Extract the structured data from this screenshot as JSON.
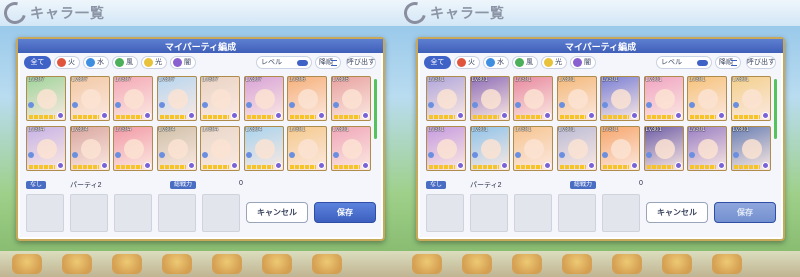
{
  "screen": {
    "title": "キャラ一覧"
  },
  "dialog": {
    "title": "マイパーティ編成",
    "filters": {
      "all": "全て",
      "fire": "火",
      "water": "水",
      "wind": "風",
      "light": "光",
      "dark": "闇",
      "sort_label": "レベル",
      "direction_label": "降順",
      "call_label": "呼び出す"
    },
    "status": {
      "slot_tag": "なし",
      "party_name": "パーティ2",
      "power_tag": "総戦力",
      "power_value": "0"
    },
    "buttons": {
      "cancel": "キャンセル",
      "save": "保存"
    }
  },
  "colors": {
    "accent": "#3f62c7",
    "fire": "#e0553d",
    "water": "#3f8fe0",
    "wind": "#4cb05a",
    "light": "#e8c23a",
    "dark": "#8a5fd0"
  },
  "left_panel": {
    "cards": [
      {
        "level": "Lv307"
      },
      {
        "level": "Lv307"
      },
      {
        "level": "Lv307"
      },
      {
        "level": "Lv307"
      },
      {
        "level": "Lv307"
      },
      {
        "level": "Lv307"
      },
      {
        "level": "Lv306"
      },
      {
        "level": "Lv305"
      },
      {
        "level": "Lv304"
      },
      {
        "level": "Lv304"
      },
      {
        "level": "Lv304"
      },
      {
        "level": "Lv304"
      },
      {
        "level": "Lv304"
      },
      {
        "level": "Lv304"
      },
      {
        "level": "Lv301"
      },
      {
        "level": "Lv301"
      }
    ]
  },
  "right_panel": {
    "cards": [
      {
        "level": "Lv301"
      },
      {
        "level": "Lv301"
      },
      {
        "level": "Lv301"
      },
      {
        "level": "Lv301"
      },
      {
        "level": "Lv301"
      },
      {
        "level": "Lv301"
      },
      {
        "level": "Lv301"
      },
      {
        "level": "Lv301"
      },
      {
        "level": "Lv301"
      },
      {
        "level": "Lv301"
      },
      {
        "level": "Lv301"
      },
      {
        "level": "Lv301"
      },
      {
        "level": "Lv301"
      },
      {
        "level": "Lv301"
      },
      {
        "level": "Lv301"
      },
      {
        "level": "Lv301"
      }
    ]
  }
}
